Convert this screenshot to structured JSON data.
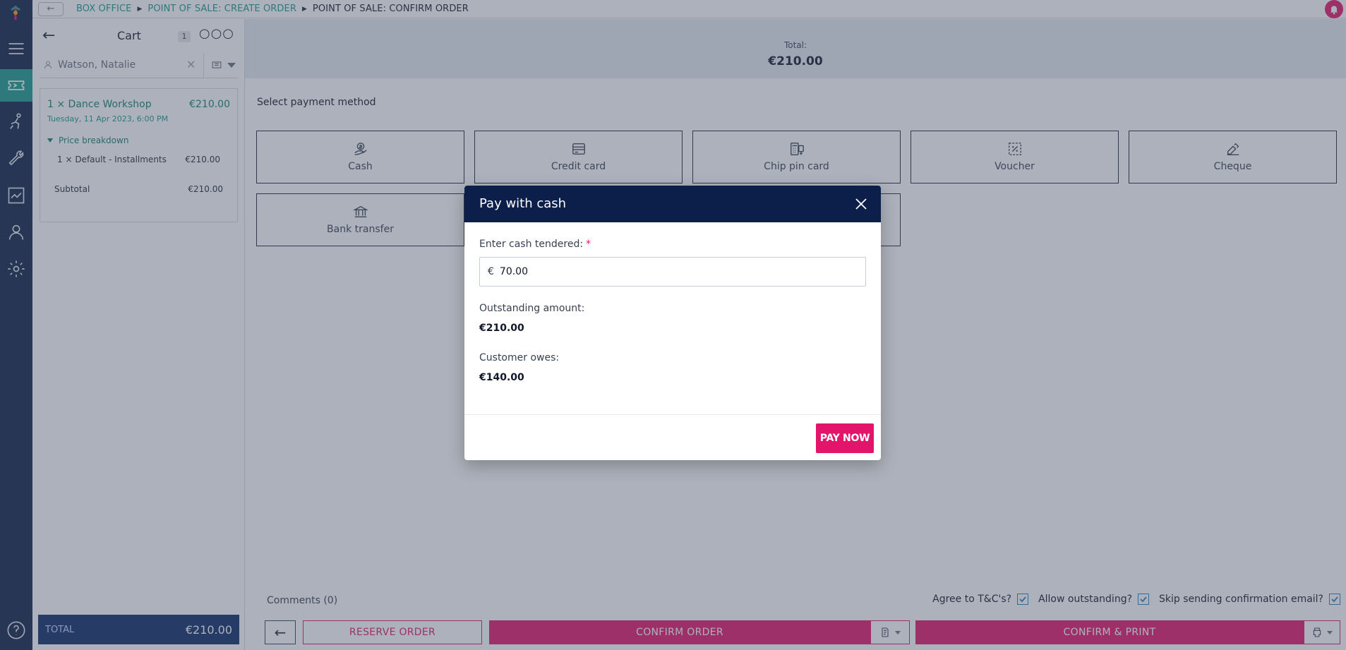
{
  "breadcrumb": {
    "items": [
      "BOX OFFICE",
      "POINT OF SALE: CREATE ORDER",
      "POINT OF SALE: CONFIRM ORDER"
    ]
  },
  "cart": {
    "title": "Cart",
    "count": "1",
    "customer_name": "Watson, Natalie",
    "item": {
      "title": "1 × Dance Workshop",
      "price": "€210.00",
      "date": "Tuesday, 11 Apr 2023, 6:00 PM"
    },
    "price_breakdown_label": "Price breakdown",
    "breakdown_line": {
      "label": "1 × Default - Installments",
      "value": "€210.00"
    },
    "subtotal_label": "Subtotal",
    "subtotal_value": "€210.00",
    "total_label": "TOTAL",
    "total_value": "€210.00"
  },
  "main": {
    "total_label": "Total:",
    "total_value": "€210.00",
    "select_label": "Select payment method",
    "payment_methods": [
      {
        "label": "Cash",
        "icon": "cash-hand-icon"
      },
      {
        "label": "Credit card",
        "icon": "credit-card-icon"
      },
      {
        "label": "Chip pin card",
        "icon": "chip-pin-card-icon"
      },
      {
        "label": "Voucher",
        "icon": "voucher-icon"
      },
      {
        "label": "Cheque",
        "icon": "cheque-icon"
      },
      {
        "label": "Bank transfer",
        "icon": "bank-icon"
      }
    ],
    "comments_label": "Comments (0)",
    "checkboxes": [
      {
        "label": "Agree to T&C's?",
        "checked": true
      },
      {
        "label": "Allow outstanding?",
        "checked": true
      },
      {
        "label": "Skip sending confirmation email?",
        "checked": true
      }
    ],
    "actions": {
      "reserve": "RESERVE ORDER",
      "confirm": "CONFIRM ORDER",
      "confirm_print": "CONFIRM & PRINT"
    }
  },
  "modal": {
    "title": "Pay with cash",
    "field_label": "Enter cash tendered:",
    "required_mark": "*",
    "currency_symbol": "€",
    "cash_value": "70.00",
    "outstanding_label": "Outstanding amount:",
    "outstanding_value": "€210.00",
    "owes_label": "Customer owes:",
    "owes_value": "€140.00",
    "pay_now": "PAY NOW"
  },
  "colors": {
    "navy": "#0b1f44",
    "teal": "#1a9a8a",
    "pink": "#e3156b",
    "modal_header": "#0b1f4a"
  }
}
